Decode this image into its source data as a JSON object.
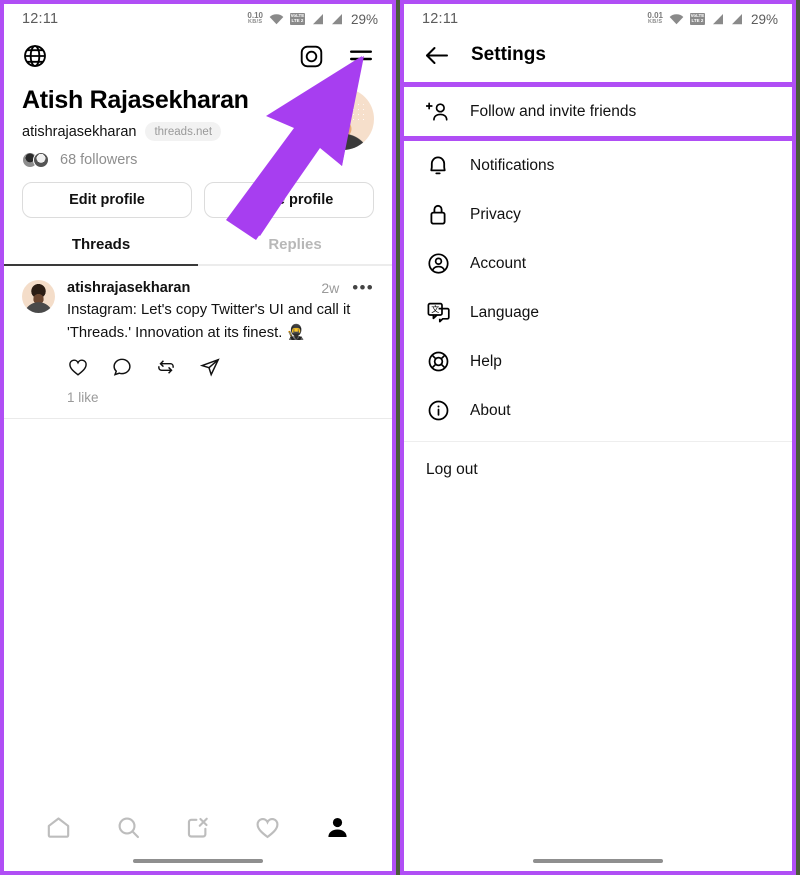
{
  "left_panel": {
    "status_bar": {
      "time": "12:11",
      "net_speed_value": "0.10",
      "net_speed_unit": "KB/S",
      "volte_line1": "VoLTE",
      "volte_line2": "LTE 2",
      "battery": "29%",
      "icons": [
        "wifi-icon",
        "volte-icon",
        "signal-icon",
        "signal-icon"
      ]
    },
    "top_actions": {
      "globe_icon": "globe-icon",
      "instagram_icon": "instagram-icon",
      "menu_icon": "hamburger-menu-icon"
    },
    "profile": {
      "name": "Atish Rajasekharan",
      "handle": "atishrajasekharan",
      "domain_pill": "threads.net",
      "followers": "68 followers",
      "edit_profile_label": "Edit profile",
      "share_profile_label": "Share profile"
    },
    "tabs": [
      {
        "label": "Threads",
        "active": true
      },
      {
        "label": "Replies",
        "active": false
      }
    ],
    "post": {
      "username": "atishrajasekharan",
      "time": "2w",
      "more_label": "•••",
      "text": "Instagram: Let's copy Twitter's UI and call it 'Threads.' Innovation at its finest. 🥷",
      "likes": "1 like",
      "actions": [
        "heart-icon",
        "comment-icon",
        "repost-icon",
        "share-icon"
      ]
    },
    "bottom_nav": [
      {
        "icon": "home-icon",
        "active": false
      },
      {
        "icon": "search-icon",
        "active": false
      },
      {
        "icon": "compose-icon",
        "active": false
      },
      {
        "icon": "heart-icon",
        "active": false
      },
      {
        "icon": "profile-icon",
        "active": true
      }
    ]
  },
  "right_panel": {
    "status_bar": {
      "time": "12:11",
      "net_speed_value": "0.01",
      "net_speed_unit": "KB/S",
      "volte_line1": "VoLTE",
      "volte_line2": "LTE 2",
      "battery": "29%"
    },
    "header": {
      "back_icon": "back-arrow-icon",
      "title": "Settings"
    },
    "items": [
      {
        "label": "Follow and invite friends",
        "icon": "add-person-icon",
        "highlighted": true
      },
      {
        "label": "Notifications",
        "icon": "bell-icon",
        "highlighted": false
      },
      {
        "label": "Privacy",
        "icon": "lock-icon",
        "highlighted": false
      },
      {
        "label": "Account",
        "icon": "account-circle-icon",
        "highlighted": false
      },
      {
        "label": "Language",
        "icon": "language-icon",
        "highlighted": false
      },
      {
        "label": "Help",
        "icon": "lifebuoy-icon",
        "highlighted": false
      },
      {
        "label": "About",
        "icon": "info-circle-icon",
        "highlighted": false
      }
    ],
    "logout_label": "Log out"
  },
  "annotation": {
    "arrow_color": "#a73ef0",
    "arrow_target": "hamburger-menu-icon",
    "highlight_color": "#b04ef5"
  }
}
